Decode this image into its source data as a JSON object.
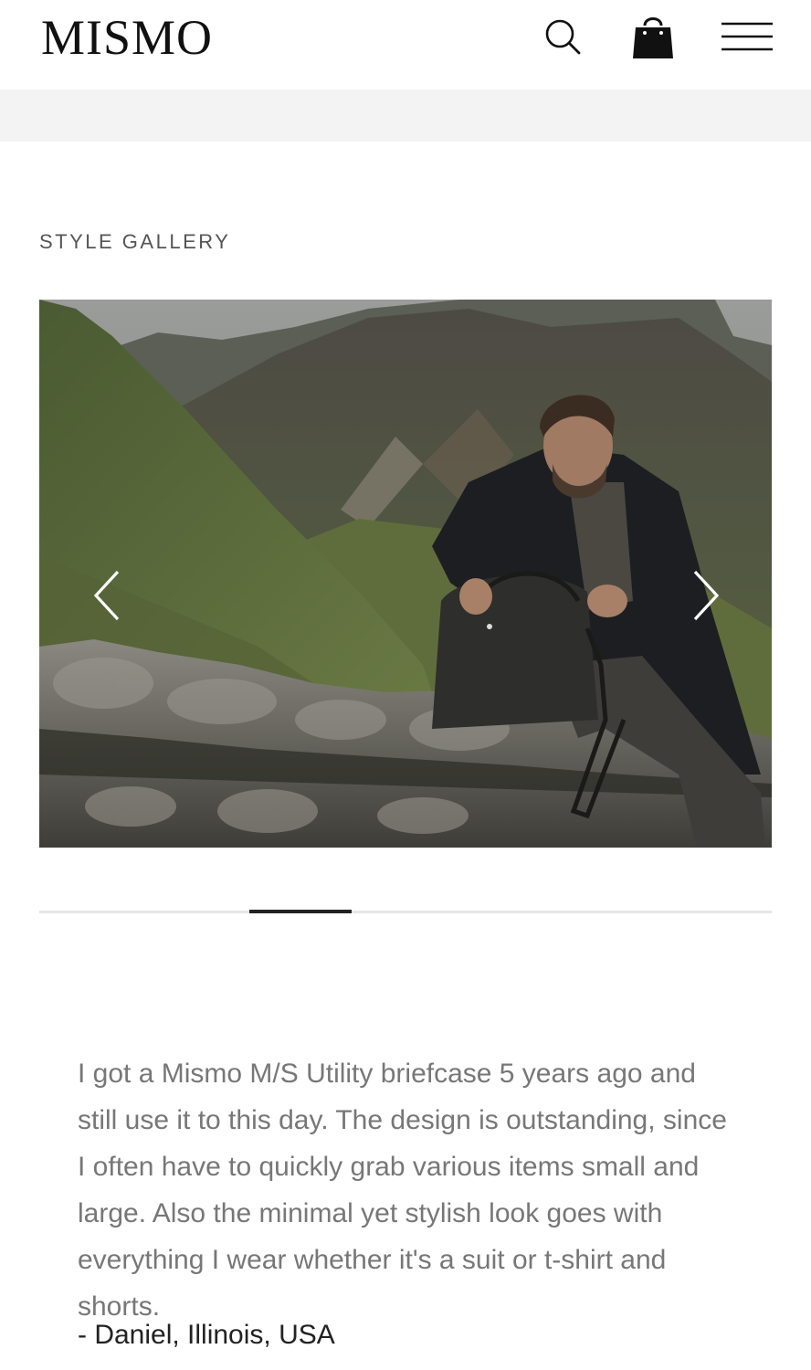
{
  "header": {
    "logo": "MISMO",
    "icons": {
      "search": "search-icon",
      "cart": "shopping-bag-icon",
      "menu": "hamburger-menu-icon"
    }
  },
  "gallery": {
    "heading": "STYLE GALLERY",
    "image_alt": "Man opening a dark camouflage bag on a stone wall in a mountain valley",
    "prev_icon": "chevron-left-icon",
    "next_icon": "chevron-right-icon",
    "progress_fraction": 0.14,
    "progress_start_fraction": 0.287
  },
  "testimonial": {
    "quote": "I got a Mismo M/S Utility briefcase 5 years ago and still use it to this day. The design is outstanding, since I often have to quickly grab various items small and large. Also the minimal yet stylish look goes with everything I wear whether it's a suit or t-shirt and shorts.",
    "author": "- Daniel, Illinois, USA"
  },
  "colors": {
    "text_dark": "#222222",
    "text_muted": "#777777",
    "strip": "#f3f3f3"
  }
}
